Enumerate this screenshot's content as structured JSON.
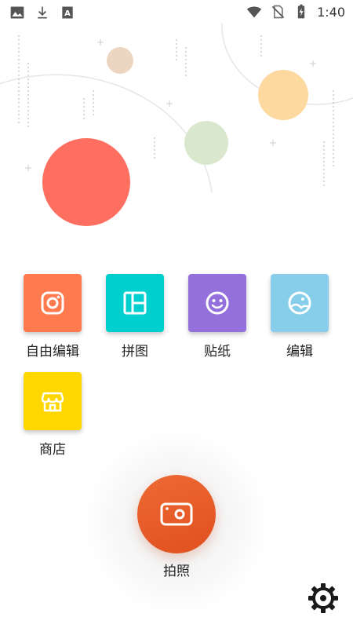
{
  "status_bar": {
    "time": "1:40",
    "left_icons": [
      "image-icon",
      "download-icon",
      "translate-icon"
    ],
    "right_icons": [
      "wifi-icon",
      "no-sim-icon",
      "battery-charging-icon"
    ]
  },
  "colors": {
    "free_edit": "#ff7b4f",
    "collage": "#00cfcf",
    "sticker": "#9370db",
    "edit": "#87ceeb",
    "store": "#ffd700",
    "capture": "#e9592a",
    "deco_red": "#ff6f61",
    "deco_orange": "#fdd9a0",
    "deco_green": "#d9e8cc",
    "deco_tan": "#ecd6c2"
  },
  "tools": [
    {
      "label": "自由编辑",
      "icon": "instagram-camera-icon"
    },
    {
      "label": "拼图",
      "icon": "collage-grid-icon"
    },
    {
      "label": "贴纸",
      "icon": "smiley-sticker-icon"
    },
    {
      "label": "编辑",
      "icon": "photo-edit-icon"
    },
    {
      "label": "商店",
      "icon": "store-icon"
    }
  ],
  "capture": {
    "label": "拍照",
    "icon": "camera-icon"
  },
  "settings": {
    "icon": "gear-icon"
  }
}
